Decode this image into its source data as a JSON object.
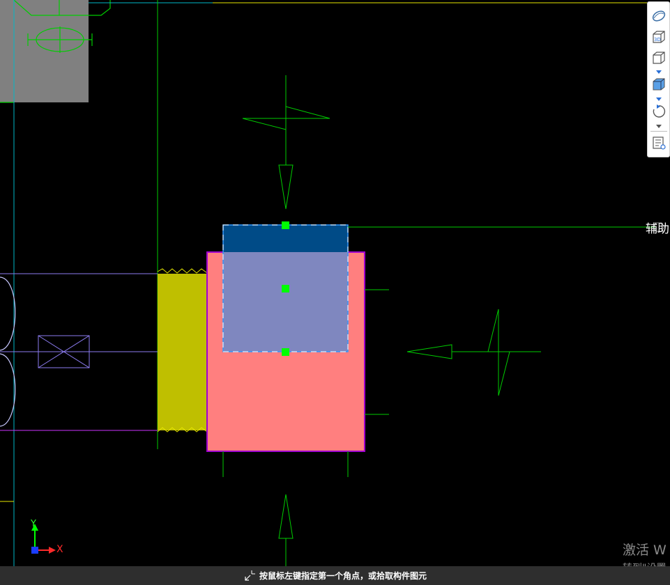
{
  "toolbar": {
    "buttons": [
      {
        "name": "view-cube-ellipse-icon"
      },
      {
        "name": "3d-view-icon",
        "text": "3D"
      },
      {
        "name": "display-mode-icon"
      },
      {
        "name": "solid-box-icon"
      },
      {
        "name": "rotate-icon"
      },
      {
        "name": "properties-icon"
      }
    ]
  },
  "canvas": {
    "aux_label": "辅助"
  },
  "axis": {
    "x_label": "X",
    "y_label": "Y",
    "x_color": "#ff2a2a",
    "y_color": "#2aff2a"
  },
  "status": {
    "prompt": "按鼠标左键指定第一个角点，或拾取构件图元"
  },
  "watermark": {
    "line1": "激活 W",
    "line2": "转到\"设置"
  },
  "colors": {
    "pink_component": "#ff7f7f",
    "selected_blue": "#004b87",
    "overlap_purple": "#7f87bf",
    "yellow_wall": "#bfbf00",
    "gray_block": "#808080",
    "green_line": "#00cc00",
    "grip_green": "#00ff00"
  }
}
